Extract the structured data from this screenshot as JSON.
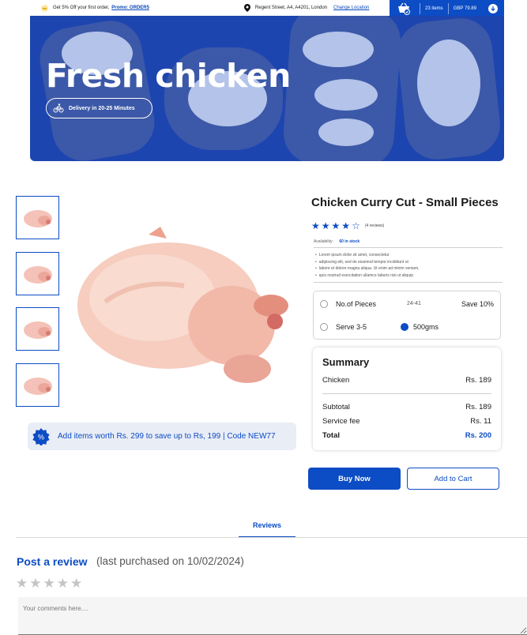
{
  "topbar": {
    "promo_text": "Get 5% Off your first order,",
    "promo_link": "Promo: ORDER5",
    "location": "Regent Street, A4, A4201, London",
    "change_location": "Change Location",
    "cart_items": "23 items",
    "cart_total": "GBP 79.89"
  },
  "hero": {
    "title": "Fresh chicken",
    "delivery": "Delivery in 20-25 Minutes"
  },
  "promo_strip": {
    "badge": "%",
    "text": "Add items worth Rs. 299 to save up to Rs, 199 | Code NEW77"
  },
  "product": {
    "title": "Chicken Curry Cut - Small Pieces",
    "rating": 4,
    "rating_max": 5,
    "reviews": "(4 reviews)",
    "availability_label": "Availability:",
    "availability_value": "60 in stock",
    "description": [
      "Lorem ipsum dolor sit amet, consectetur",
      "adipiscing elit, sed do eiusmod tempor incididunt ut",
      "labore et dolore magna aliqua. Ut enim ad minim veniam,",
      "quis nostrud exercitation ullamco laboris nisi ut aliquip"
    ]
  },
  "options": {
    "pieces_label": "No.of Pieces",
    "pieces_value": "24-41",
    "save": "Save 10%",
    "serve_label": "Serve 3-5",
    "weight": "500gms"
  },
  "summary": {
    "title": "Summary",
    "item_label": "Chicken",
    "item_price": "Rs. 189",
    "subtotal_label": "Subtotal",
    "subtotal_value": "Rs. 189",
    "fee_label": "Service fee",
    "fee_value": "Rs. 11",
    "total_label": "Total",
    "total_value": "Rs. 200"
  },
  "actions": {
    "buy_now": "Buy Now",
    "add_to_cart": "Add to Cart"
  },
  "reviews": {
    "tab": "Reviews",
    "post_title": "Post a review",
    "last_purchased": "(last purchased on 10/02/2024)",
    "comment_placeholder": "Your comments here....",
    "rating_stars": 5
  },
  "colors": {
    "primary": "#0c4cc4",
    "hero_bg": "#1d45b0",
    "promo_strip_bg": "#e9edf6"
  }
}
